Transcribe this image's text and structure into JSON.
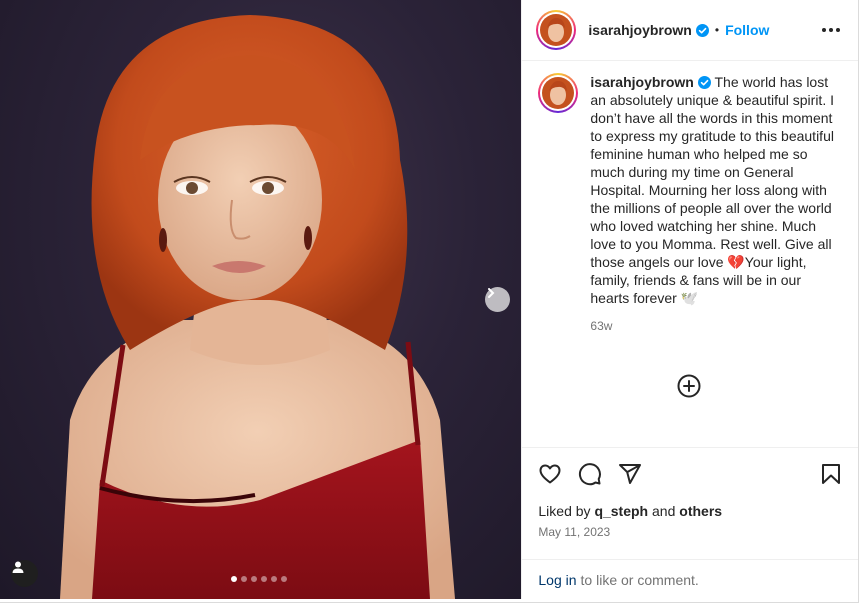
{
  "post": {
    "username": "isarahjoybrown",
    "separator": "•",
    "follow_label": "Follow",
    "caption": "The world has lost an absolutely unique & beautiful spirit. I don’t have all the words in this moment to express my gratitude to this beautiful feminine human who helped me so much during my time on General Hospital. Mourning her loss along with the millions of people all over the world who loved watching her shine. Much love to you Momma. Rest well. Give all those angels our love 💔Your light, family, friends & fans will be in our hearts forever 🕊️",
    "time_ago": "63w",
    "likes_prefix": "Liked by",
    "liked_by_user": "q_steph",
    "likes_and": "and",
    "likes_others": "others",
    "date": "May 11, 2023",
    "login_link": "Log in",
    "login_suffix": "to like or comment."
  },
  "carousel": {
    "total": 6,
    "current": 1
  },
  "icons": {
    "verified": "verified-badge-icon",
    "more": "more-options-icon",
    "next": "chevron-right-icon",
    "tag": "user-tag-icon",
    "add_comment": "add-circle-icon",
    "like": "heart-icon",
    "comment": "comment-bubble-icon",
    "share": "paper-plane-icon",
    "save": "bookmark-icon"
  },
  "colors": {
    "accent": "#0095f6",
    "verified": "#0095f6",
    "text": "#262626",
    "muted": "#737373",
    "link": "#00376b"
  }
}
